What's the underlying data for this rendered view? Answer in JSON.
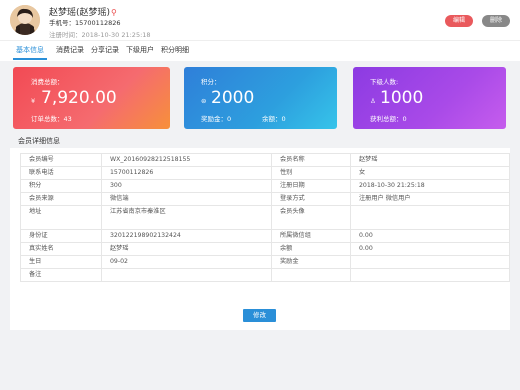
{
  "header": {
    "name": "赵梦瑶(赵梦瑶)",
    "phone": "手机号：15700112826",
    "register_time": "注册时间：2018-10-30  21:25:18",
    "edit_label": "编辑",
    "delete_label": "删除"
  },
  "tabs": [
    "基本信息",
    "消费记录",
    "分享记录",
    "下级用户",
    "积分明细"
  ],
  "cards": {
    "consume": {
      "label": "消费总额：",
      "symbol": "¥",
      "value": "7,920.00",
      "sub": "订单总数：43"
    },
    "points": {
      "label": "积分：",
      "symbol": "⊜",
      "value": "2000",
      "sub1": "奖励金：0",
      "sub2": "余额：0"
    },
    "downline": {
      "label": "下级人数:",
      "symbol": "♙",
      "value": "1000",
      "sub": "获利总额：0"
    }
  },
  "section_title": "会员详细信息",
  "table": {
    "rows": [
      [
        "会员编号",
        "WX_20160928212518155",
        "会员名称",
        "赵梦瑶"
      ],
      [
        "联系电话",
        "15700112826",
        "性别",
        "女"
      ],
      [
        "积分",
        "300",
        "注册日期",
        "2018-10-30  21:25:18"
      ],
      [
        "会员来源",
        "微信端",
        "登录方式",
        "注册用户   微信用户"
      ],
      [
        "地址",
        "江苏省南京市秦淮区",
        "会员头像",
        ""
      ],
      [
        "身份证",
        "320122198902132424",
        "所属微信组",
        "0.00"
      ],
      [
        "真实姓名",
        "赵梦瑶",
        "余额",
        "0.00"
      ],
      [
        "生日",
        "09-02",
        "奖励金",
        ""
      ],
      [
        "备注",
        "",
        "",
        ""
      ]
    ]
  },
  "save_label": "修改"
}
